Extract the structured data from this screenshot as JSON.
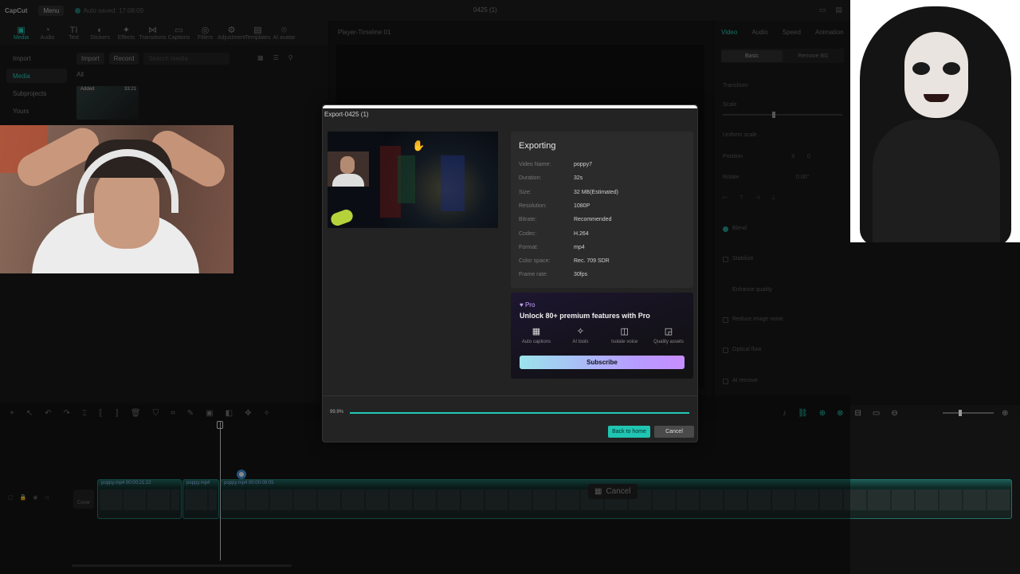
{
  "window": {
    "logo": "CapCut",
    "menu_label": "Menu",
    "autosave": "Auto saved: 17:08:09",
    "doc_title": "0425 (1)"
  },
  "toolbar": {
    "items": [
      {
        "icon": "media-icon",
        "glyph": "▣",
        "label": "Media"
      },
      {
        "icon": "audio-icon",
        "glyph": "◔",
        "label": "Audio"
      },
      {
        "icon": "text-icon",
        "glyph": "TI",
        "label": "Text"
      },
      {
        "icon": "stickers-icon",
        "glyph": "◐",
        "label": "Stickers"
      },
      {
        "icon": "effects-icon",
        "glyph": "✦",
        "label": "Effects"
      },
      {
        "icon": "transitions-icon",
        "glyph": "⋈",
        "label": "Transitions"
      },
      {
        "icon": "captions-icon",
        "glyph": "▭",
        "label": "Captions"
      },
      {
        "icon": "filters-icon",
        "glyph": "◎",
        "label": "Filters"
      },
      {
        "icon": "adjustment-icon",
        "glyph": "⚙",
        "label": "Adjustment"
      },
      {
        "icon": "templates-icon",
        "glyph": "▤",
        "label": "Templates"
      },
      {
        "icon": "ai-avatar-icon",
        "glyph": "⌾",
        "label": "AI avatar"
      }
    ]
  },
  "media_panel": {
    "nav": [
      "Import",
      "Media",
      "Subprojects",
      "Yours"
    ],
    "import_label": "Import",
    "record_label": "Record",
    "search_placeholder": "Search media",
    "all_tab": "All",
    "thumb_added": "Added",
    "thumb_duration": "33:21"
  },
  "player": {
    "title": "Player-Timeline 01"
  },
  "inspector": {
    "tabs": [
      "Video",
      "Audio",
      "Speed",
      "Animation"
    ],
    "basic": "Basic",
    "remove_bg": "Remove BG",
    "transform": "Transform",
    "scale": "Scale",
    "uniform_scale": "Uniform scale",
    "position": "Position",
    "position_x_label": "X",
    "position_x": "0",
    "rotate": "Rotate",
    "rotate_val": "0.00°",
    "blend": "Blend",
    "stabilize": "Stabilize",
    "enhance_quality": "Enhance quality",
    "reduce_noise": "Reduce image noise",
    "optical_flow": "Optical flow",
    "ai_remove": "AI remove"
  },
  "dialog": {
    "title": "Export-0425 (1)",
    "status": "Exporting",
    "rows": [
      {
        "k": "Video Name:",
        "v": "poppy7"
      },
      {
        "k": "Duration:",
        "v": "32s"
      },
      {
        "k": "Size:",
        "v": "32 MB(Estimated)"
      },
      {
        "k": "Resolution:",
        "v": "1080P"
      },
      {
        "k": "Bitrate:",
        "v": "Recommended"
      },
      {
        "k": "Codec:",
        "v": "H.264"
      },
      {
        "k": "Format:",
        "v": "mp4"
      },
      {
        "k": "Color space:",
        "v": "Rec. 709 SDR"
      },
      {
        "k": "Frame rate:",
        "v": "30fps"
      }
    ],
    "pro_badge": "♥ Pro",
    "pro_title": "Unlock 80+ premium features with Pro",
    "features": [
      {
        "icon": "auto-captions-icon",
        "glyph": "▦",
        "label": "Auto captions"
      },
      {
        "icon": "ai-tools-icon",
        "glyph": "✧",
        "label": "AI tools"
      },
      {
        "icon": "isolate-voice-icon",
        "glyph": "◫",
        "label": "Isolate voice"
      },
      {
        "icon": "quality-assets-icon",
        "glyph": "◲",
        "label": "Quality assets"
      }
    ],
    "subscribe_label": "Subscribe",
    "progress_text": "99.9%",
    "progress_value": 0.999,
    "back_home_label": "Back to home",
    "cancel_label": "Cancel"
  },
  "timeline": {
    "clip1_label": "poppy.mp4  00:00:21:22",
    "clip2_label": "poppy.mp4",
    "clip3_label": "poppy.mp4  00:00:09:05",
    "cover_label": "Cover",
    "cancel_ghost": "Cancel"
  },
  "colors": {
    "accent": "#1fb7a6",
    "progress": "#22c8b7",
    "pro": "#c9a3ff"
  }
}
